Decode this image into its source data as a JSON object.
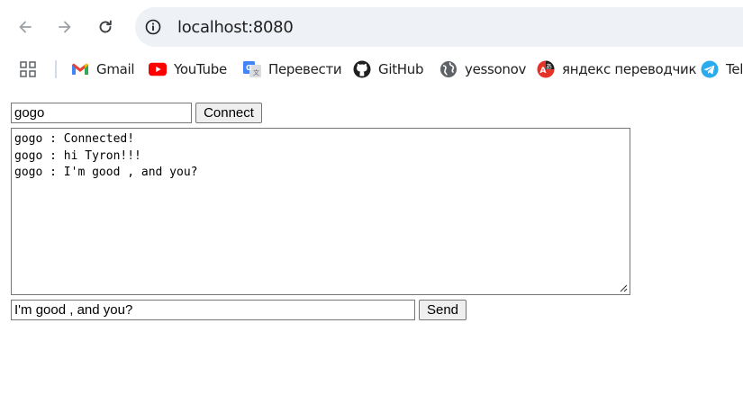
{
  "browser": {
    "url": "localhost:8080",
    "bookmarks": [
      {
        "label": "Gmail",
        "icon": "gmail-icon"
      },
      {
        "label": "YouTube",
        "icon": "youtube-icon"
      },
      {
        "label": "Перевести",
        "icon": "google-translate-icon"
      },
      {
        "label": "GitHub",
        "icon": "github-icon"
      },
      {
        "label": "yessonov",
        "icon": "globe-icon"
      },
      {
        "label": "яндекс переводчик",
        "icon": "yandex-translate-icon"
      },
      {
        "label": "Tele",
        "icon": "telegram-icon"
      }
    ],
    "colors": {
      "omnibox": "#eef1f6",
      "youtube": "#ff0000",
      "telegram": "#2aabee"
    }
  },
  "page": {
    "name_value": "gogo",
    "connect_label": "Connect",
    "log_lines": [
      "gogo : Connected!",
      "gogo : hi Tyron!!!",
      "gogo : I'm good , and you?"
    ],
    "message_value": "I'm good , and you?",
    "send_label": "Send"
  }
}
